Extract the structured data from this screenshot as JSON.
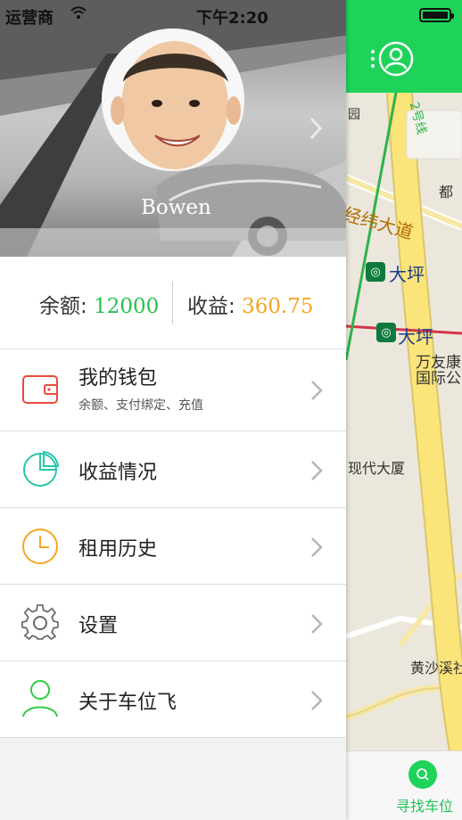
{
  "status_bar": {
    "carrier": "运营商",
    "time": "下午2:20"
  },
  "profile": {
    "name": "Bowen"
  },
  "balance": {
    "balance_label": "余额: ",
    "balance_value": "12000",
    "earnings_label": "收益: ",
    "earnings_value": "360.75"
  },
  "menu": [
    {
      "label": "我的钱包",
      "sub": "余额、支付绑定、充值",
      "icon": "wallet-icon"
    },
    {
      "label": "收益情况",
      "icon": "pie-chart-icon"
    },
    {
      "label": "租用历史",
      "icon": "clock-icon"
    },
    {
      "label": "设置",
      "icon": "gear-icon"
    },
    {
      "label": "关于车位飞",
      "icon": "person-icon"
    }
  ],
  "map": {
    "labels": {
      "park": "园",
      "line": "2号线",
      "road": "经纬大道",
      "poi_partial": "都",
      "station1": "大坪",
      "station2": "大坪",
      "building1a": "万友康",
      "building1b": "国际公",
      "building2": "现代大厦",
      "building3": "黄沙溪社"
    }
  },
  "footer": {
    "find_label": "寻找车位"
  },
  "colors": {
    "accent": "#1fd35a",
    "balance": "#27c24c",
    "earnings": "#f5a623",
    "wallet": "#e74c3c",
    "chart": "#26c6a8",
    "clock": "#f5a623",
    "about": "#2ecc40"
  }
}
